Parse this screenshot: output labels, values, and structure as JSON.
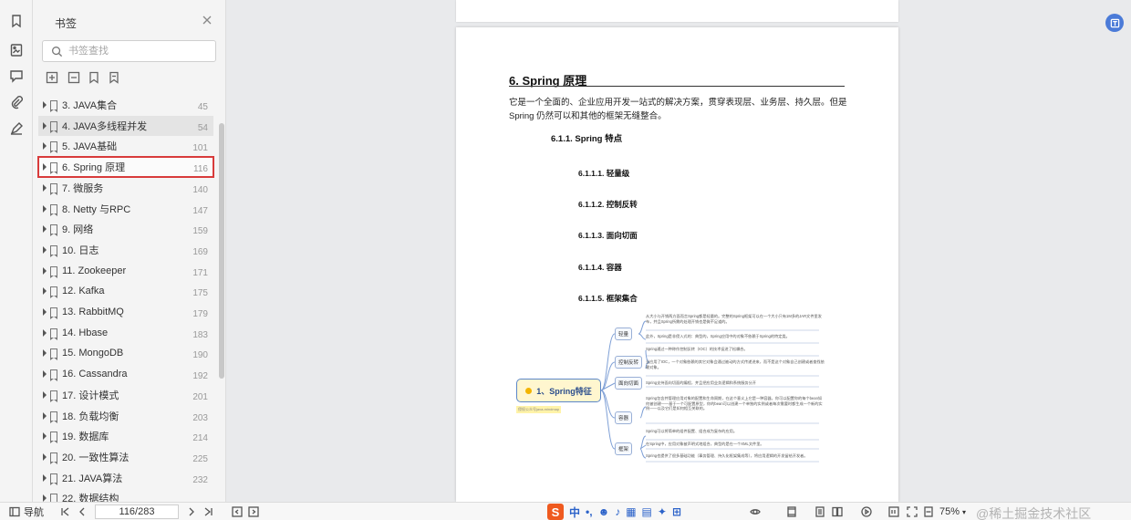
{
  "panel": {
    "title": "书签",
    "search_placeholder": "书签查找"
  },
  "bookmarks": [
    {
      "label": "3. JAVA集合",
      "page": "45",
      "state": "normal"
    },
    {
      "label": "4. JAVA多线程并发",
      "page": "54",
      "state": "hover"
    },
    {
      "label": "5. JAVA基础",
      "page": "101",
      "state": "normal"
    },
    {
      "label": "6. Spring 原理",
      "page": "116",
      "state": "selected"
    },
    {
      "label": "7.   微服务",
      "page": "140",
      "state": "normal"
    },
    {
      "label": "8. Netty 与RPC",
      "page": "147",
      "state": "normal"
    },
    {
      "label": "9. 网络",
      "page": "159",
      "state": "normal"
    },
    {
      "label": "10. 日志",
      "page": "169",
      "state": "normal"
    },
    {
      "label": "11. Zookeeper",
      "page": "171",
      "state": "normal"
    },
    {
      "label": "12. Kafka",
      "page": "175",
      "state": "normal"
    },
    {
      "label": "13. RabbitMQ",
      "page": "179",
      "state": "normal"
    },
    {
      "label": "14. Hbase",
      "page": "183",
      "state": "normal"
    },
    {
      "label": "15. MongoDB",
      "page": "190",
      "state": "normal"
    },
    {
      "label": "16. Cassandra",
      "page": "192",
      "state": "normal"
    },
    {
      "label": "17. 设计模式",
      "page": "201",
      "state": "normal"
    },
    {
      "label": "18. 负载均衡",
      "page": "203",
      "state": "normal"
    },
    {
      "label": "19. 数据库",
      "page": "214",
      "state": "normal"
    },
    {
      "label": "20. 一致性算法",
      "page": "225",
      "state": "normal"
    },
    {
      "label": "21. JAVA算法",
      "page": "232",
      "state": "normal"
    },
    {
      "label": "22. 数据结构",
      "page": "",
      "state": "normal"
    }
  ],
  "document": {
    "heading": "6. Spring 原理",
    "paragraph": "它是一个全面的、企业应用开发一站式的解决方案，贯穿表现层、业务层、持久层。但是 Spring 仍然可以和其他的框架无缝整合。",
    "section": "6.1.1.  Spring 特点",
    "subsections": [
      "6.1.1.1.    轻量级",
      "6.1.1.2.    控制反转",
      "6.1.1.3.    面向切面",
      "6.1.1.4.    容器",
      "6.1.1.5.    框架集合"
    ],
    "mindmap": {
      "root": "1、Spring特征",
      "tag": "侵权公众号java-mindmap",
      "nodes": [
        "轻量",
        "控制反转",
        "面向切面",
        "容器",
        "框架"
      ],
      "leaves": [
        "从大小与开销两方面而言Spring都是轻量的。完整的Spring框架可以在一个大小只有1M多的JAR文件里发布，并且Spring所需的处理开销也是微不足道的。",
        "此外，Spring是非侵入式的：典型的，Spring应用中的对象不依赖于Spring的特定类。",
        "Spring通过一种称作控制反转（IOC）的技术促进了松耦合。",
        "当应用了IOC，一个对象依赖的其它对象会通过被动的方式传递进来，而不是这个对象自己创建或者查找依赖对象。",
        "Spring支持面向切面的编程，并且把应用业务逻辑和系统服务分开",
        "Spring包含并管理应用对象的配置和生命周期，在这个意义上它是一种容器，你可以配置你的每个bean如何被创建——基于一个可配置原型，你的bean可以创建一个单独的实例或者每次需要时都生成一个新的实例——以及它们是如何相互关联的。",
        "Spring可以将简单的组件配置、组合成为复杂的应用。",
        "在Spring中，应用对象被声明式地组合，典型的是在一个XML文件里。",
        "Spring也提供了很多基础功能（事务管理、持久化框架集成等），将应用逻辑的开发留给开发者。"
      ]
    }
  },
  "statusbar": {
    "nav_label": "导航",
    "page_value": "116/283",
    "zoom": "75%",
    "ime_label": "中",
    "watermark": "@稀土掘金技术社区"
  },
  "icons": [
    "bookmark-icon",
    "thumbnail-icon",
    "comment-icon",
    "attachment-icon",
    "signature-icon",
    "close-icon",
    "search-icon"
  ]
}
